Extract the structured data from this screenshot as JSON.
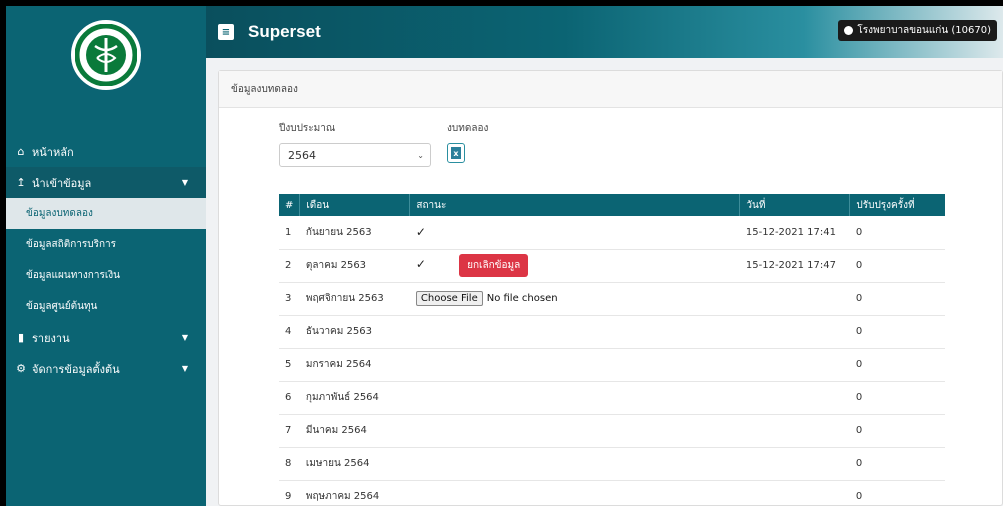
{
  "brand": "Superset",
  "user_label": "โรงพยาบาลขอนแก่น (10670)",
  "sidebar": {
    "items": [
      {
        "label": "หน้าหลัก",
        "icon": "home-icon"
      },
      {
        "label": "นำเข้าข้อมูล",
        "icon": "upload-icon"
      },
      {
        "label": "รายงาน",
        "icon": "file-icon"
      },
      {
        "label": "จัดการข้อมูลตั้งต้น",
        "icon": "gear-icon"
      }
    ],
    "sub_items": [
      "ข้อมูลงบทดลอง",
      "ข้อมูลสถิติการบริการ",
      "ข้อมูลแผนทางการเงิน",
      "ข้อมูลศูนย์ต้นทุน"
    ]
  },
  "card": {
    "title": "ข้อมูลงบทดลอง",
    "filter_year_label": "ปีงบประมาณ",
    "filter_trial_label": "งบทดลอง",
    "year_value": "2564"
  },
  "table": {
    "headers": [
      "#",
      "เดือน",
      "สถานะ",
      "วันที่",
      "ปรับปรุงครั้งที่"
    ],
    "rows": [
      {
        "n": "1",
        "month": "กันยายน 2563",
        "date": "15-12-2021 17:41",
        "rev": "0"
      },
      {
        "n": "2",
        "month": "ตุลาคม 2563",
        "date": "15-12-2021 17:47",
        "rev": "0"
      },
      {
        "n": "3",
        "month": "พฤศจิกายน 2563",
        "date": "",
        "rev": "0"
      },
      {
        "n": "4",
        "month": "ธันวาคม 2563",
        "date": "",
        "rev": "0"
      },
      {
        "n": "5",
        "month": "มกราคม 2564",
        "date": "",
        "rev": "0"
      },
      {
        "n": "6",
        "month": "กุมภาพันธ์ 2564",
        "date": "",
        "rev": "0"
      },
      {
        "n": "7",
        "month": "มีนาคม 2564",
        "date": "",
        "rev": "0"
      },
      {
        "n": "8",
        "month": "เมษายน 2564",
        "date": "",
        "rev": "0"
      },
      {
        "n": "9",
        "month": "พฤษภาคม 2564",
        "date": "",
        "rev": "0"
      }
    ],
    "check_mark": "✓",
    "cancel_label": "ยกเลิกข้อมูล",
    "choose_file_label": "Choose File",
    "no_file_label": "No file chosen"
  }
}
